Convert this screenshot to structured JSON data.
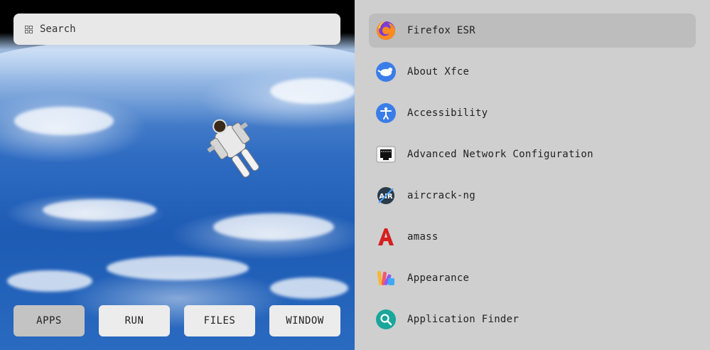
{
  "search": {
    "placeholder": "Search",
    "icon": "apps-grid-icon"
  },
  "tabs": [
    {
      "label": "APPS",
      "active": true
    },
    {
      "label": "RUN",
      "active": false
    },
    {
      "label": "FILES",
      "active": false
    },
    {
      "label": "WINDOW",
      "active": false
    }
  ],
  "apps": [
    {
      "label": "Firefox ESR",
      "icon": "firefox-icon",
      "selected": true
    },
    {
      "label": "About Xfce",
      "icon": "xfce-mouse-icon"
    },
    {
      "label": "Accessibility",
      "icon": "accessibility-icon"
    },
    {
      "label": "Advanced Network Configuration",
      "icon": "network-port-icon"
    },
    {
      "label": "aircrack-ng",
      "icon": "aircrack-icon"
    },
    {
      "label": "amass",
      "icon": "amass-icon"
    },
    {
      "label": "Appearance",
      "icon": "appearance-palette-icon"
    },
    {
      "label": "Application Finder",
      "icon": "app-finder-magnifier-icon"
    }
  ],
  "colors": {
    "panel_bg": "#cfcfcf",
    "selected_bg": "#bdbdbd",
    "button_bg": "#ececec",
    "active_button_bg": "#c3c3c3",
    "accent_blue": "#3b7de8"
  }
}
